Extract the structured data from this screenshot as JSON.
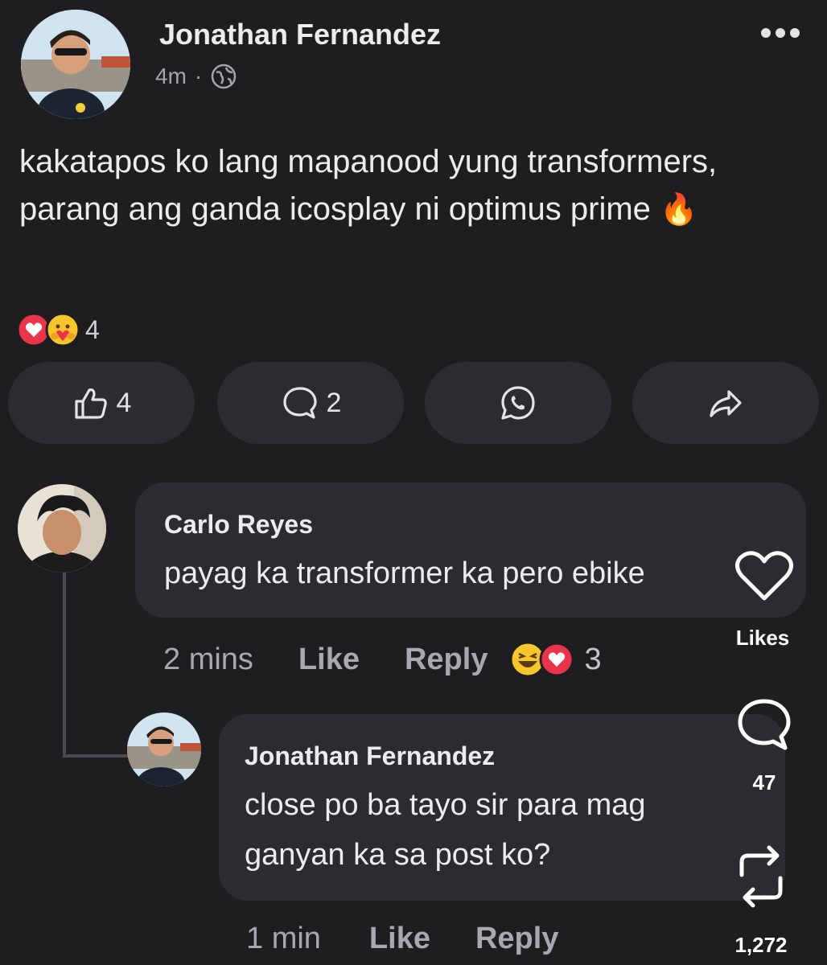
{
  "post": {
    "author": "Jonathan Fernandez",
    "time": "4m",
    "separator": "·",
    "text": "kakatapos ko lang mapanood yung transformers, parang ang ganda icosplay ni optimus prime",
    "text_emoji": "🔥",
    "reaction_count": "4",
    "actions": {
      "like_count": "4",
      "comment_count": "2"
    }
  },
  "comments": [
    {
      "author": "Carlo Reyes",
      "text": "payag ka transformer ka pero ebike",
      "time": "2 mins",
      "like_label": "Like",
      "reply_label": "Reply",
      "reaction_count": "3"
    }
  ],
  "reply": {
    "author": "Jonathan Fernandez",
    "text_line1": "close po ba tayo sir para mag",
    "text_line2": "ganyan ka sa post ko?",
    "time": "1 min",
    "like_label": "Like",
    "reply_label": "Reply"
  },
  "side_overlay": {
    "likes_label": "Likes",
    "comments_count": "47",
    "reposts_count": "1,272"
  },
  "colors": {
    "background": "#1e1e20",
    "surface": "#2c2c30",
    "love_red": "#e8354a",
    "haha_yellow": "#f7c52c",
    "flame_orange": "#f47b20"
  }
}
